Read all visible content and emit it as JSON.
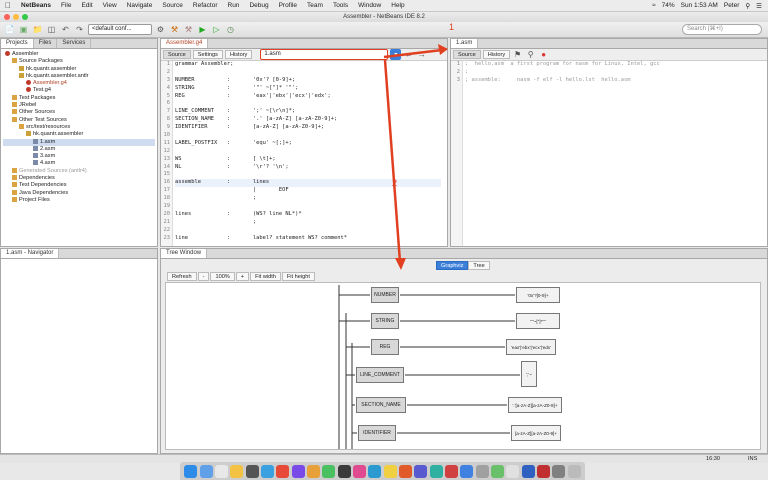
{
  "menubar": {
    "app_name": "NetBeans",
    "items": [
      "File",
      "Edit",
      "View",
      "Navigate",
      "Source",
      "Refactor",
      "Run",
      "Debug",
      "Profile",
      "Team",
      "Tools",
      "Window",
      "Help"
    ],
    "battery": "74%",
    "clock": "Sun 1:53 AM",
    "user": "Peter"
  },
  "window": {
    "title": "Assembler - NetBeans IDE 8.2"
  },
  "toolbar": {
    "config": "<default conf...",
    "search_placeholder": "Search (⌘+I)"
  },
  "projects": {
    "tabs": [
      "Projects",
      "Files",
      "Services"
    ],
    "tree": [
      {
        "label": "Assembler",
        "level": 0,
        "icon": "project"
      },
      {
        "label": "Source Packages",
        "level": 1,
        "icon": "folder"
      },
      {
        "label": "hk.quantr.assembler",
        "level": 2,
        "icon": "package"
      },
      {
        "label": "hk.quantr.assembler.antlr",
        "level": 2,
        "icon": "package"
      },
      {
        "label": "Assembler.g4",
        "level": 3,
        "icon": "antlr",
        "color": "#b04020"
      },
      {
        "label": "Test.g4",
        "level": 3,
        "icon": "antlr"
      },
      {
        "label": "Test Packages",
        "level": 1,
        "icon": "folder"
      },
      {
        "label": "JRebel",
        "level": 1,
        "icon": "folder"
      },
      {
        "label": "Other Sources",
        "level": 1,
        "icon": "folder"
      },
      {
        "label": "Other Test Sources",
        "level": 1,
        "icon": "folder"
      },
      {
        "label": "src/test/resources",
        "level": 2,
        "icon": "folder"
      },
      {
        "label": "hk.quantr.assembler",
        "level": 3,
        "icon": "package"
      },
      {
        "label": "1.asm",
        "level": 4,
        "icon": "file",
        "selected": true
      },
      {
        "label": "2.asm",
        "level": 4,
        "icon": "file"
      },
      {
        "label": "3.asm",
        "level": 4,
        "icon": "file"
      },
      {
        "label": "4.asm",
        "level": 4,
        "icon": "file"
      },
      {
        "label": "Generated Sources (antlr4)",
        "level": 1,
        "icon": "folder",
        "muted": true
      },
      {
        "label": "Dependencies",
        "level": 1,
        "icon": "folder"
      },
      {
        "label": "Test Dependencies",
        "level": 1,
        "icon": "folder"
      },
      {
        "label": "Java Dependencies",
        "level": 1,
        "icon": "folder"
      },
      {
        "label": "Project Files",
        "level": 1,
        "icon": "folder"
      }
    ]
  },
  "editor": {
    "tab": "Assembler.g4",
    "subtabs": [
      "Source",
      "Settings",
      "History"
    ],
    "file_combo": "1.asm",
    "lines": [
      {
        "n": "1",
        "t": "grammar Assembler;"
      },
      {
        "n": "2",
        "t": ""
      },
      {
        "n": "3",
        "t": "NUMBER          :       '0x'? [0-9]+;"
      },
      {
        "n": "4",
        "t": "STRING          :       '\"' ~[\"]* '\"';"
      },
      {
        "n": "5",
        "t": "REG             :       'eax'|'ebx'|'ecx'|'edx';"
      },
      {
        "n": "6",
        "t": ""
      },
      {
        "n": "7",
        "t": "LINE_COMMENT    :       ';' ~[\\r\\n]*;"
      },
      {
        "n": "8",
        "t": "SECTION_NAME    :       '.' [a-zA-Z] [a-zA-Z0-9]+;"
      },
      {
        "n": "9",
        "t": "IDENTIFIER      :       [a-zA-Z] [a-zA-Z0-9]+;"
      },
      {
        "n": "10",
        "t": ""
      },
      {
        "n": "11",
        "t": "LABEL_POSTFIX   :       'equ' ~[;]+;"
      },
      {
        "n": "12",
        "t": ""
      },
      {
        "n": "13",
        "t": "WS              :       [ \\t]+;"
      },
      {
        "n": "14",
        "t": "NL              :       '\\r'? '\\n';"
      },
      {
        "n": "15",
        "t": ""
      },
      {
        "n": "16",
        "t": "assemble        :       lines"
      },
      {
        "n": "17",
        "t": "                        |       EOF"
      },
      {
        "n": "18",
        "t": "                        ;"
      },
      {
        "n": "19",
        "t": ""
      },
      {
        "n": "20",
        "t": "lines           :       (WS? line NL*)*"
      },
      {
        "n": "21",
        "t": "                        ;"
      },
      {
        "n": "22",
        "t": ""
      },
      {
        "n": "23",
        "t": "line            :       label? statement WS? comment*"
      }
    ]
  },
  "asm_editor": {
    "tab": "1.asm",
    "subtabs": [
      "Source",
      "History"
    ],
    "lines": [
      {
        "n": "1",
        "t": ";  hello.asm  a first program for nasm for Linux, Intel, gcc"
      },
      {
        "n": "2",
        "t": ";"
      },
      {
        "n": "3",
        "t": "; assemble:     nasm -f elf -l hello.lst  hello.asm"
      }
    ]
  },
  "annotations": {
    "one": "1",
    "two": "2"
  },
  "navigator": {
    "title": "1.asm - Navigator"
  },
  "tree_window": {
    "title": "Tree Window",
    "tabs": [
      "Graphviz",
      "Tree"
    ],
    "buttons": [
      "Refresh",
      "-",
      "100%",
      "+",
      "Fit width",
      "Fit height"
    ],
    "rules": [
      {
        "name": "NUMBER",
        "value": "'0x'?[0-9]+"
      },
      {
        "name": "STRING",
        "value": "'\"'~[\"]*'\"'"
      },
      {
        "name": "REG",
        "value": "'eax'|'ebx'|'ecx'|'edx'"
      },
      {
        "name": "LINE_COMMENT",
        "value": "';'~[\\r\\n]*"
      },
      {
        "name": "SECTION_NAME",
        "value": "'.'[a-zA-Z][a-zA-Z0-9]+"
      },
      {
        "name": "IDENTIFIER",
        "value": "[a-zA-Z][a-zA-Z0-9]+"
      }
    ]
  },
  "statusbar": {
    "position": "16:30",
    "mode": "INS"
  }
}
